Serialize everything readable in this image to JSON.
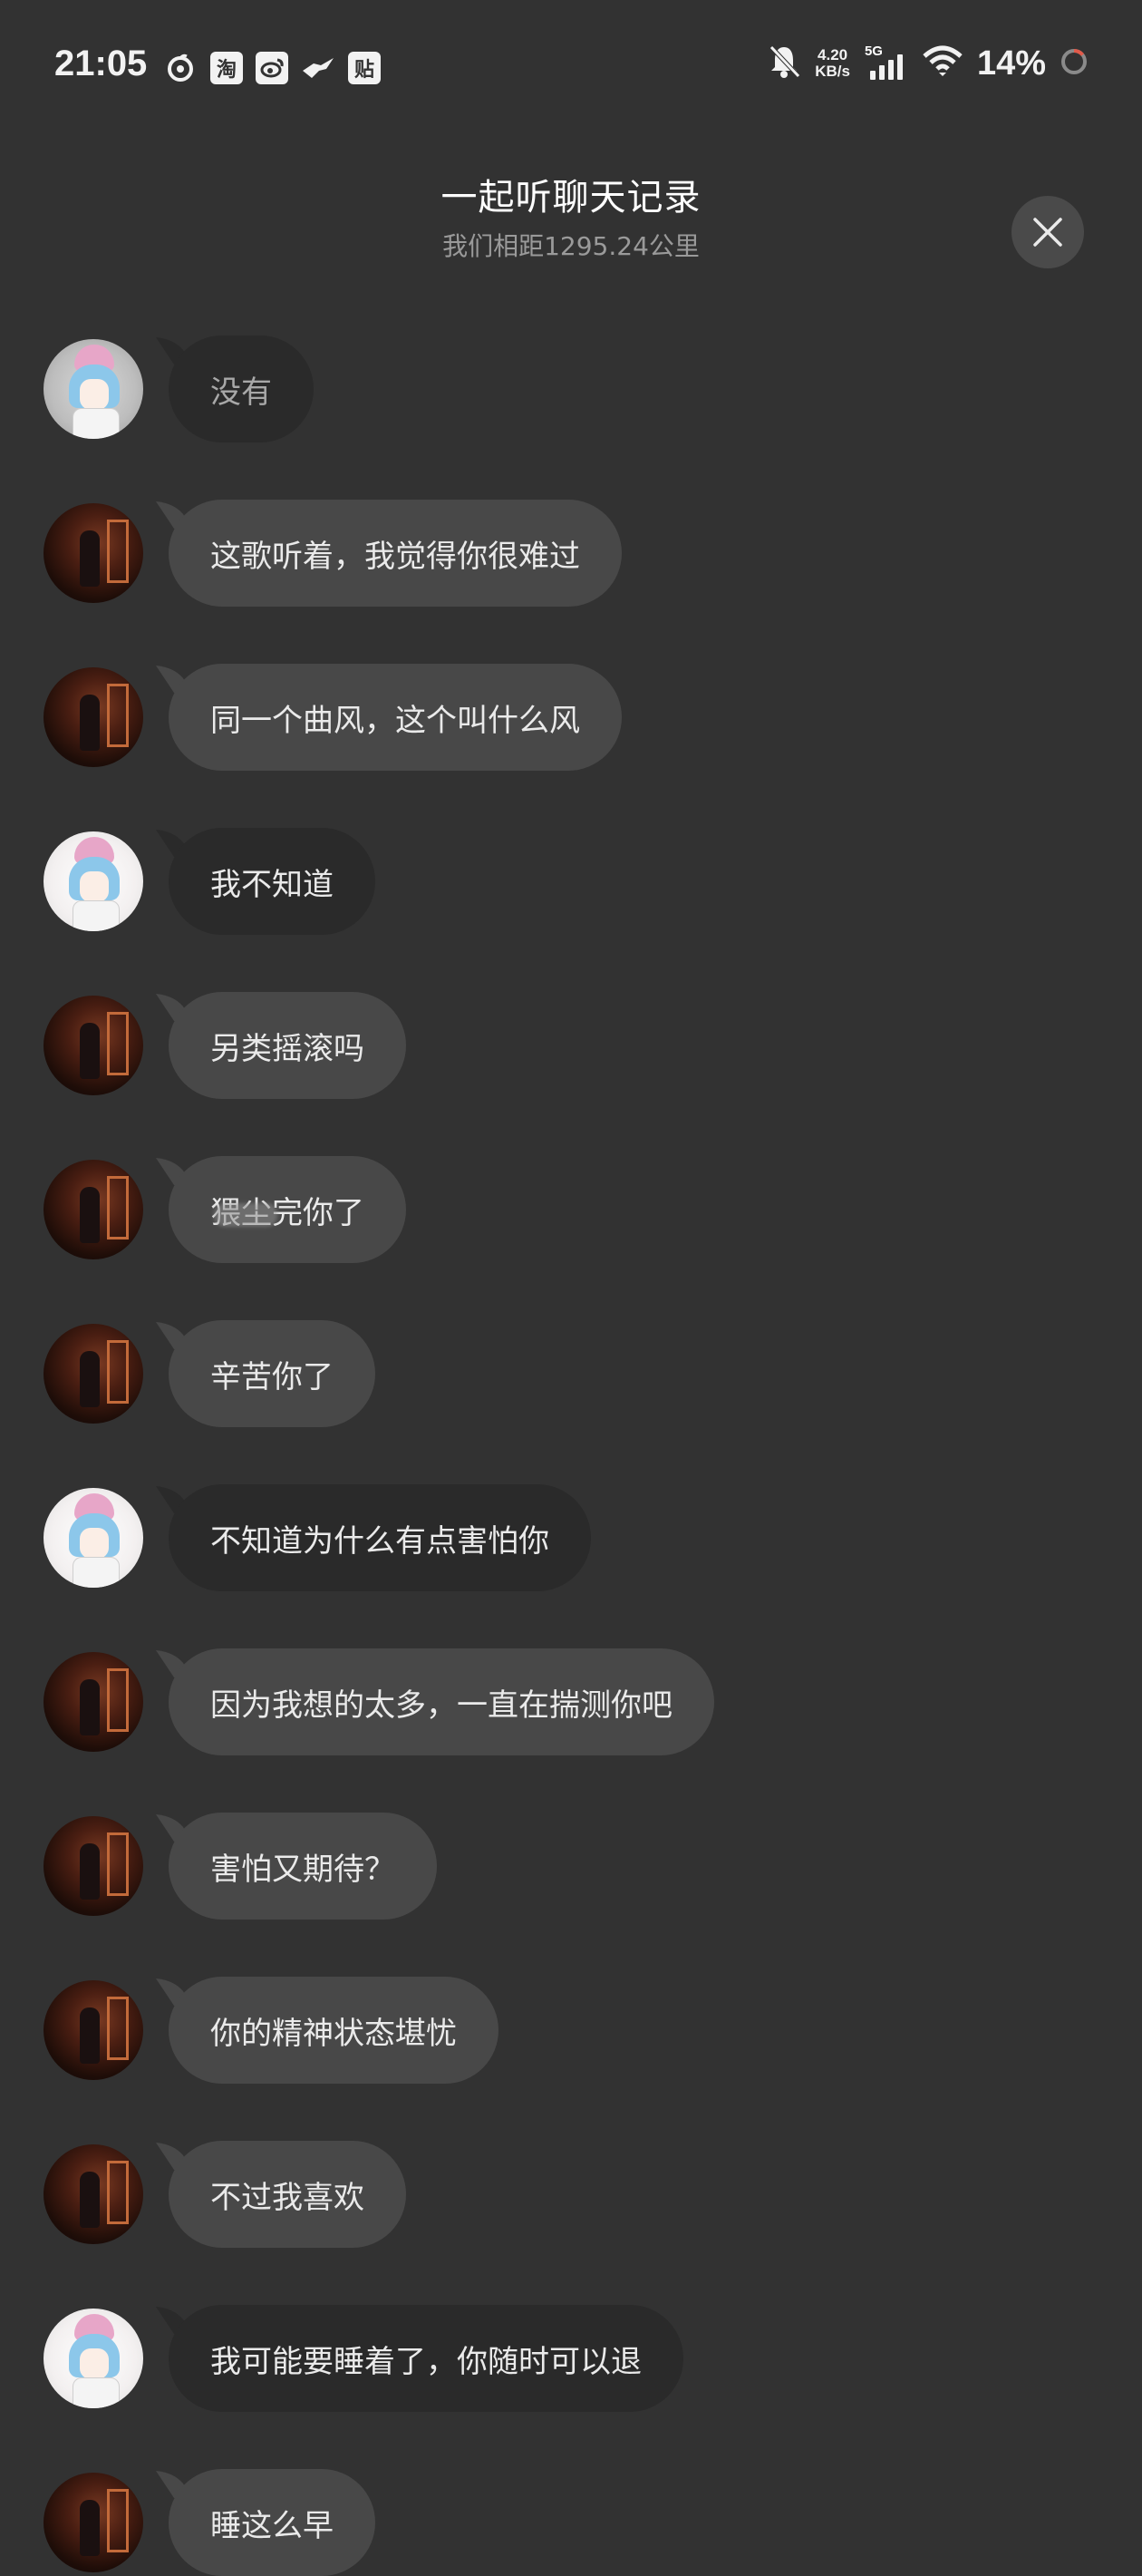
{
  "status_bar": {
    "time": "21:05",
    "net_speed_value": "4.20",
    "net_speed_unit": "KB/s",
    "network_type": "5G",
    "battery_percent": "14%",
    "left_icons": [
      "netease-music-icon",
      "taobao-icon",
      "weibo-icon",
      "bird-app-icon",
      "tieba-icon"
    ],
    "taobao_glyph": "淘",
    "tieba_glyph": "贴"
  },
  "header": {
    "title": "一起听聊天记录",
    "subtitle": "我们相距1295.24公里"
  },
  "messages": [
    {
      "sender": "me",
      "text": "没有",
      "faded": true
    },
    {
      "sender": "other",
      "text": "这歌听着，我觉得你很难过"
    },
    {
      "sender": "other",
      "text": "同一个曲风，这个叫什么风"
    },
    {
      "sender": "me",
      "text": "我不知道"
    },
    {
      "sender": "other",
      "text": "另类摇滚吗"
    },
    {
      "sender": "other",
      "text": "猥尘完你了"
    },
    {
      "sender": "other",
      "text": "辛苦你了"
    },
    {
      "sender": "me",
      "text": "不知道为什么有点害怕你"
    },
    {
      "sender": "other",
      "text": "因为我想的太多，一直在揣测你吧"
    },
    {
      "sender": "other",
      "text": "害怕又期待？"
    },
    {
      "sender": "other",
      "text": "你的精神状态堪忧"
    },
    {
      "sender": "other",
      "text": "不过我喜欢"
    },
    {
      "sender": "me",
      "text": "我可能要睡着了，你随时可以退"
    },
    {
      "sender": "other",
      "text": "睡这么早"
    }
  ],
  "colors": {
    "background": "#323232",
    "bubble_other": "#484848",
    "bubble_me": "#2a2a2a",
    "subtitle": "#9a9a9a",
    "battery_ring": "#e05a4a"
  }
}
